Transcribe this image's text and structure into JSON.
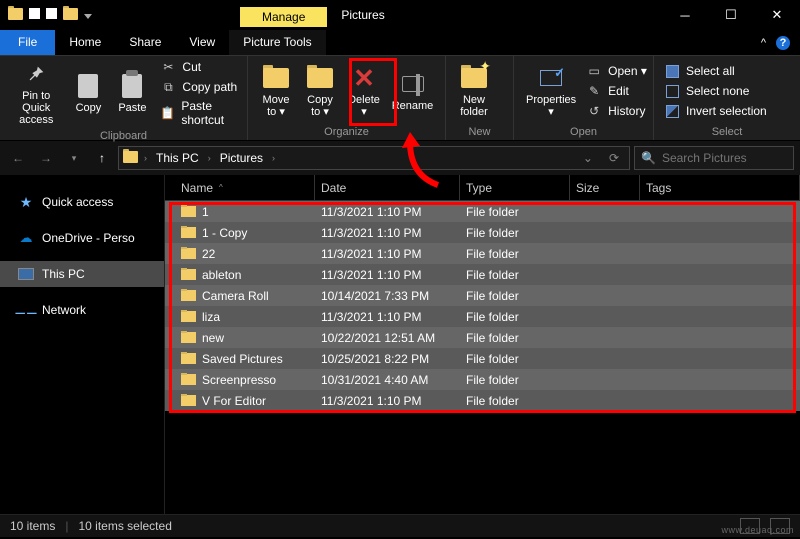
{
  "title_context": "Manage",
  "title_context_tool": "Picture Tools",
  "window_title": "Pictures",
  "tabs": {
    "file": "File",
    "home": "Home",
    "share": "Share",
    "view": "View",
    "context": "Picture Tools"
  },
  "ribbon": {
    "clipboard": {
      "label": "Clipboard",
      "pin": "Pin to Quick\naccess",
      "copy": "Copy",
      "paste": "Paste",
      "cut": "Cut",
      "copy_path": "Copy path",
      "paste_shortcut": "Paste shortcut"
    },
    "organize": {
      "label": "Organize",
      "move": "Move\nto ▾",
      "copy": "Copy\nto ▾",
      "delete": "Delete\n▾",
      "rename": "Rename"
    },
    "new": {
      "label": "New",
      "new_folder": "New\nfolder"
    },
    "open": {
      "label": "Open",
      "properties": "Properties\n▾",
      "open": "Open ▾",
      "edit": "Edit",
      "history": "History"
    },
    "select": {
      "label": "Select",
      "all": "Select all",
      "none": "Select none",
      "invert": "Invert selection"
    }
  },
  "nav": {
    "back": "Back",
    "fwd": "Forward",
    "up": "Up"
  },
  "breadcrumbs": [
    "This PC",
    "Pictures"
  ],
  "search_placeholder": "Search Pictures",
  "sidebar": [
    {
      "label": "Quick access",
      "icon": "star"
    },
    {
      "label": "OneDrive - Perso",
      "icon": "cloud"
    },
    {
      "label": "This PC",
      "icon": "pc",
      "selected": true
    },
    {
      "label": "Network",
      "icon": "net"
    }
  ],
  "columns": [
    "Name",
    "Date",
    "Type",
    "Size",
    "Tags"
  ],
  "rows": [
    {
      "name": "1",
      "date": "11/3/2021 1:10 PM",
      "type": "File folder"
    },
    {
      "name": "1 - Copy",
      "date": "11/3/2021 1:10 PM",
      "type": "File folder"
    },
    {
      "name": "22",
      "date": "11/3/2021 1:10 PM",
      "type": "File folder"
    },
    {
      "name": "ableton",
      "date": "11/3/2021 1:10 PM",
      "type": "File folder"
    },
    {
      "name": "Camera Roll",
      "date": "10/14/2021 7:33 PM",
      "type": "File folder"
    },
    {
      "name": "liza",
      "date": "11/3/2021 1:10 PM",
      "type": "File folder"
    },
    {
      "name": "new",
      "date": "10/22/2021 12:51 AM",
      "type": "File folder"
    },
    {
      "name": "Saved Pictures",
      "date": "10/25/2021 8:22 PM",
      "type": "File folder"
    },
    {
      "name": "Screenpresso",
      "date": "10/31/2021 4:40 AM",
      "type": "File folder"
    },
    {
      "name": "V For Editor",
      "date": "11/3/2021 1:10 PM",
      "type": "File folder"
    }
  ],
  "status": {
    "count": "10 items",
    "selected": "10 items selected"
  },
  "watermark": "www.deuaq.com"
}
